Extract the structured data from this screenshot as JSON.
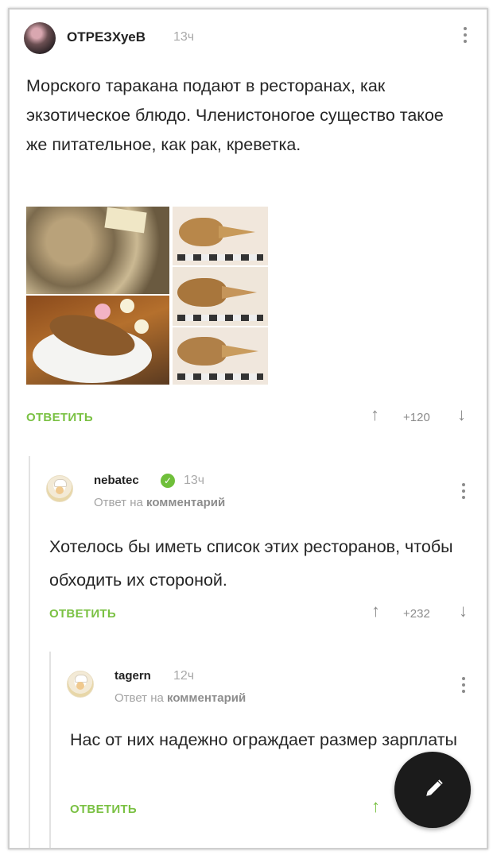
{
  "post": {
    "author": "ОТРЕЗХуеВ",
    "time": "13ч",
    "text": "Морского таракана подают в ресторанах, как экзотическое блюдо. Членистоногое существо такое же питательное, как рак, креветка.",
    "reply_label": "ОТВЕТИТЬ",
    "score": "+120"
  },
  "comments": [
    {
      "author": "nebatec",
      "time": "13ч",
      "answer_prefix": "Ответ на",
      "answer_target": "комментарий",
      "text": "Хотелось бы иметь список этих ресторанов, чтобы обходить их стороной.",
      "reply_label": "ОТВЕТИТЬ",
      "score": "+232"
    },
    {
      "author": "tagern",
      "time": "12ч",
      "answer_prefix": "Ответ на",
      "answer_target": "комментарий",
      "text": "Нас от них надежно ограждает размер зарплаты",
      "reply_label": "ОТВЕТИТЬ"
    }
  ],
  "icons": {
    "upvote": "arrow-up-icon",
    "downvote": "arrow-down-icon",
    "more": "kebab-menu-icon",
    "fab": "pencil-icon"
  },
  "colors": {
    "accent": "#7ac143",
    "muted": "#8b8b8b",
    "fab": "#1b1b1b"
  }
}
